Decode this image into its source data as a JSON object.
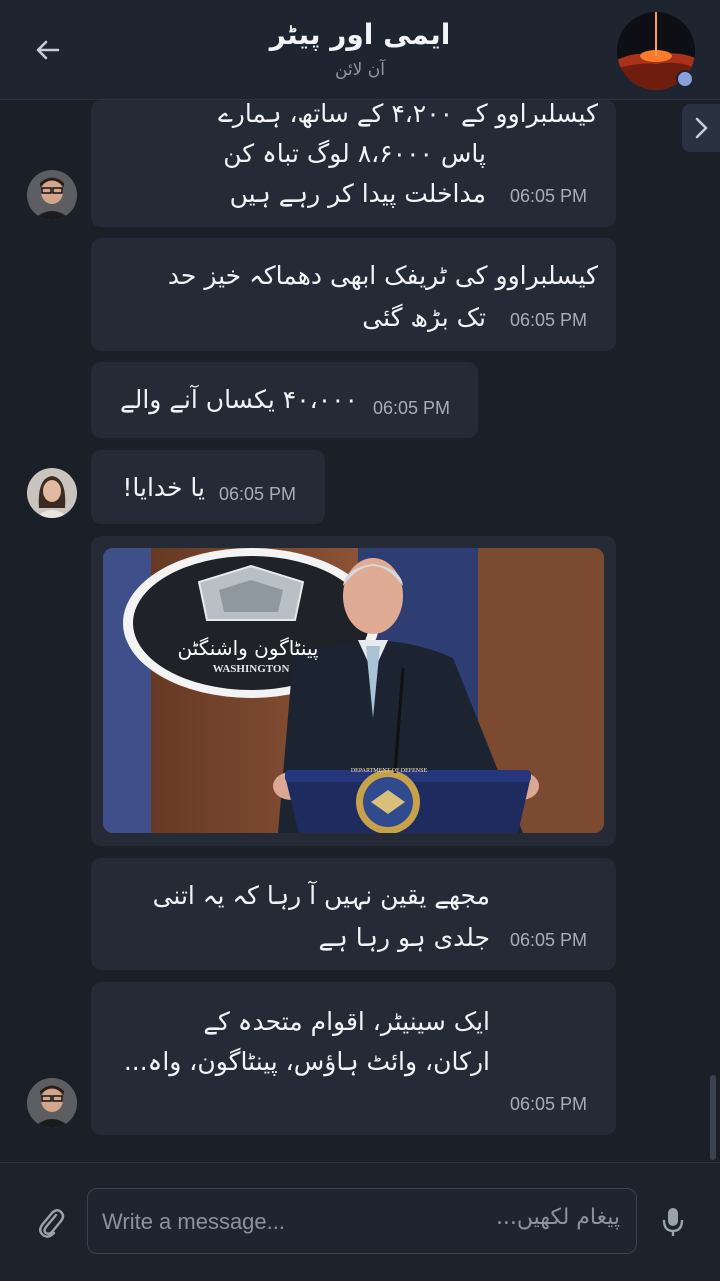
{
  "header": {
    "title": "ایمی اور پیٹر",
    "status": "آن لائن"
  },
  "messages": [
    {
      "text_line1": "کیسلبراوو کے ۴،۲۰۰ کے ساتھ، ہمارے",
      "text_line2": "پاس ۸،۶۰۰۰ لوگ تباہ کن",
      "text_line3": "مداخلت پیدا کر رہے ہیں",
      "time": "06:05 PM"
    },
    {
      "text_line1": "کیسلبراوو کی ٹریفک ابھی دھماکہ خیز حد",
      "text_line2": "تک بڑھ گئی",
      "time": "06:05 PM"
    },
    {
      "text_line1": "۴۰،۰۰۰ یکساں آنے والے",
      "time": "06:05 PM"
    },
    {
      "text_line1": "یا خدایا!",
      "time": "06:05 PM"
    },
    {
      "image_caption": "پینٹاگون واشنگٹن",
      "seal_text": "WASHINGTON",
      "podium_seal_text": "DEPARTMENT OF DEFENSE"
    },
    {
      "text_line1": "مجھے یقین نہیں آ رہا کہ یہ اتنی",
      "text_line2": "جلدی ہو رہا ہے",
      "time": "06:05 PM"
    },
    {
      "text_line1": "ایک سینیٹر، اقوام متحدہ کے",
      "text_line2": "ارکان، وائٹ ہاؤس، پینٹاگون، واہ...",
      "time": "06:05 PM"
    }
  ],
  "composer": {
    "placeholder_en": "Write a message...",
    "placeholder_ur": "پیغام لکھیں..."
  },
  "icons": {
    "back": "back-arrow-icon",
    "attach": "paperclip-icon",
    "mic": "microphone-icon",
    "side": "chevron-right-icon"
  },
  "colors": {
    "background": "#1a1f28",
    "bubble": "#242a36",
    "online": "#8aa0d8"
  }
}
